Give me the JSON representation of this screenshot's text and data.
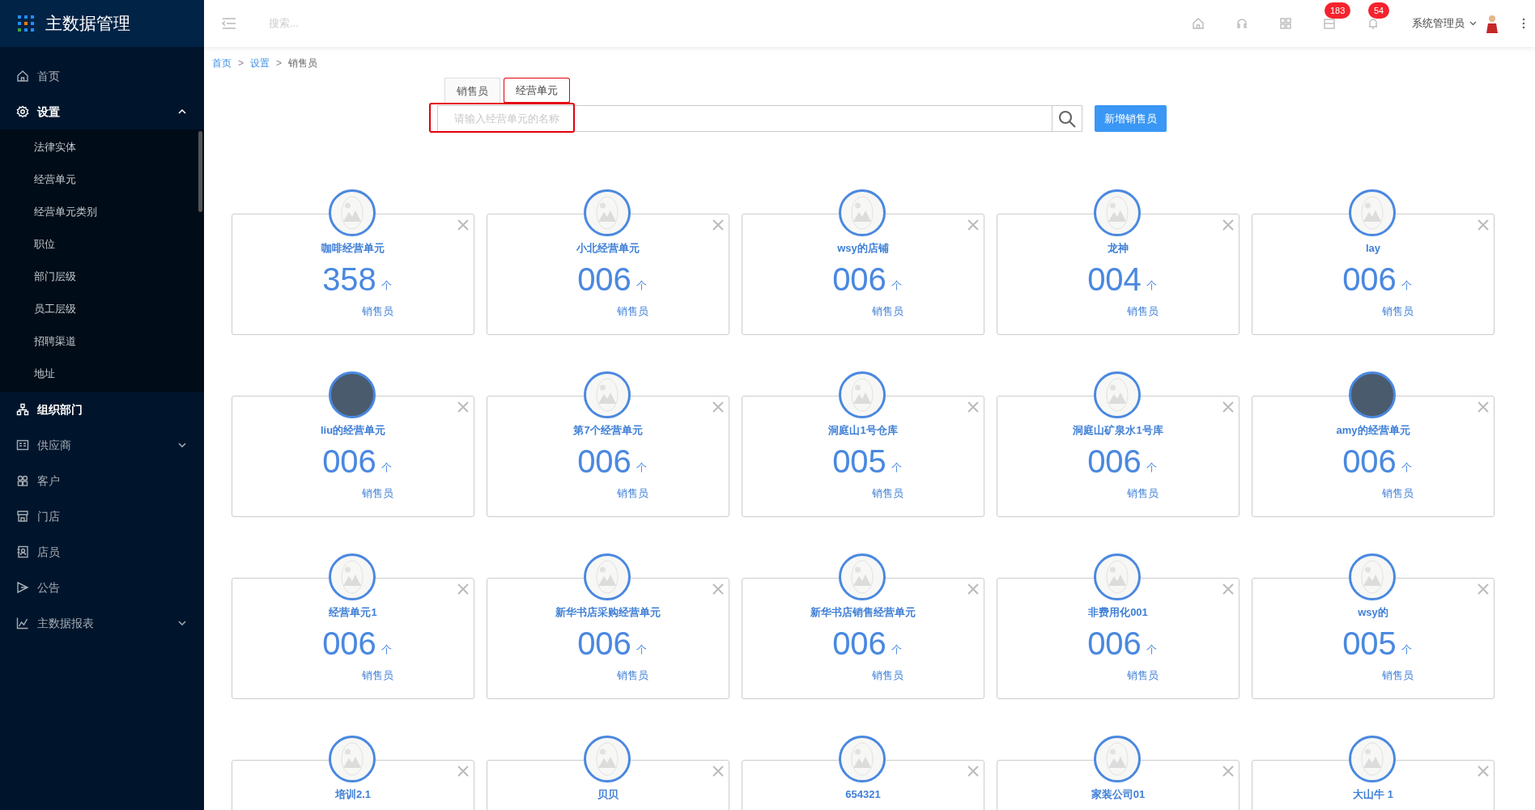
{
  "app": {
    "title": "主数据管理"
  },
  "sidebar": {
    "items": [
      {
        "label": "首页",
        "selected": false
      },
      {
        "label": "设置",
        "selected": true,
        "expanded": true,
        "children": [
          {
            "label": "法律实体"
          },
          {
            "label": "经营单元"
          },
          {
            "label": "经营单元类别"
          },
          {
            "label": "职位"
          },
          {
            "label": "部门层级"
          },
          {
            "label": "员工层级"
          },
          {
            "label": "招聘渠道"
          },
          {
            "label": "地址"
          }
        ]
      },
      {
        "label": "组织部门",
        "selected": true
      },
      {
        "label": "供应商",
        "selected": false,
        "expanded": false
      },
      {
        "label": "客户",
        "selected": false
      },
      {
        "label": "门店",
        "selected": false
      },
      {
        "label": "店员",
        "selected": false
      },
      {
        "label": "公告",
        "selected": false
      },
      {
        "label": "主数据报表",
        "selected": false,
        "expanded": false
      }
    ]
  },
  "header": {
    "search": {
      "placeholder": "搜索..."
    },
    "badges": [
      "183",
      "54"
    ],
    "user": "系统管理员"
  },
  "breadcrumb": {
    "separator": ">",
    "items": [
      "首页",
      "设置",
      "销售员"
    ]
  },
  "tabs": [
    {
      "label": "销售员",
      "selected": false,
      "highlighted": false
    },
    {
      "label": "经营单元",
      "selected": true,
      "highlighted": true
    }
  ],
  "search": {
    "placeholder": "请输入经营单元的名称",
    "highlighted": true
  },
  "add_button": "新增销售员",
  "cards": [
    {
      "name": "咖啡经营单元",
      "count": "358",
      "unit": "个",
      "label": "销售员",
      "photo": false
    },
    {
      "name": "小北经营单元",
      "count": "006",
      "unit": "个",
      "label": "销售员",
      "photo": false
    },
    {
      "name": "wsy的店铺",
      "count": "006",
      "unit": "个",
      "label": "销售员",
      "photo": false
    },
    {
      "name": "龙神",
      "count": "004",
      "unit": "个",
      "label": "销售员",
      "photo": false
    },
    {
      "name": "lay",
      "count": "006",
      "unit": "个",
      "label": "销售员",
      "photo": false
    },
    {
      "name": "liu的经营单元",
      "count": "006",
      "unit": "个",
      "label": "销售员",
      "photo": true
    },
    {
      "name": "第7个经营单元",
      "count": "006",
      "unit": "个",
      "label": "销售员",
      "photo": false
    },
    {
      "name": "洞庭山1号仓库",
      "count": "005",
      "unit": "个",
      "label": "销售员",
      "photo": false
    },
    {
      "name": "洞庭山矿泉水1号库",
      "count": "006",
      "unit": "个",
      "label": "销售员",
      "photo": false
    },
    {
      "name": "amy的经营单元",
      "count": "006",
      "unit": "个",
      "label": "销售员",
      "photo": true
    },
    {
      "name": "经营单元1",
      "count": "006",
      "unit": "个",
      "label": "销售员",
      "photo": false
    },
    {
      "name": "新华书店采购经营单元",
      "count": "006",
      "unit": "个",
      "label": "销售员",
      "photo": false
    },
    {
      "name": "新华书店销售经营单元",
      "count": "006",
      "unit": "个",
      "label": "销售员",
      "photo": false
    },
    {
      "name": "非费用化001",
      "count": "006",
      "unit": "个",
      "label": "销售员",
      "photo": false
    },
    {
      "name": "wsy的",
      "count": "005",
      "unit": "个",
      "label": "销售员",
      "photo": false
    },
    {
      "name": "培训2.1",
      "photo": false
    },
    {
      "name": "贝贝",
      "photo": false
    },
    {
      "name": "654321",
      "photo": false
    },
    {
      "name": "家装公司01",
      "photo": false
    },
    {
      "name": "大山牛 1",
      "photo": false
    }
  ]
}
